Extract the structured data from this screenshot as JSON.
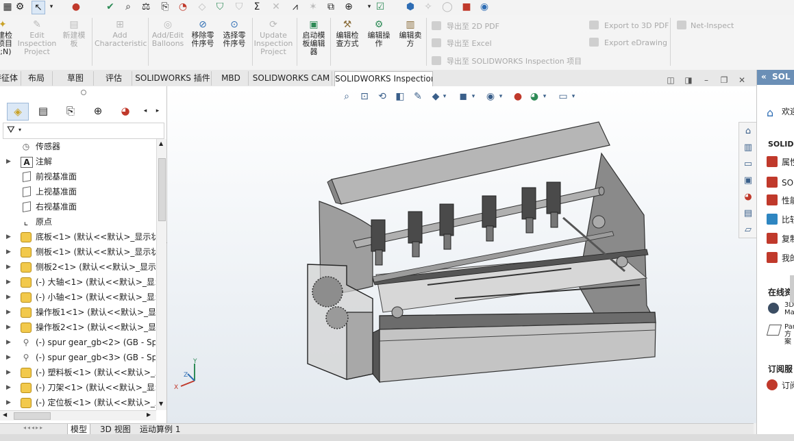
{
  "command_manager": {
    "inspection_project_label": "建检\n项目\n(;N)",
    "edit_inspection_project": "Edit\nInspection\nProject",
    "new_template": "新建模\n板",
    "add_characteristic": "Add\nCharacteristic",
    "add_edit_balloons": "Add/Edit\nBalloons",
    "remove_part_number": "移除零\n件序号",
    "select_part_number": "选择零\n件序号",
    "update_inspection_project": "Update\nInspection\nProject",
    "launch_template_editor": "启动模\n板编辑\n器",
    "edit_inspection_method": "编辑检\n查方式",
    "edit_operation": "编辑操\n作",
    "edit_vendor": "编辑卖\n方",
    "export_2d_pdf": "导出至 2D PDF",
    "export_excel": "导出至 Excel",
    "export_solidworks_inspection": "导出至 SOLIDWORKS Inspection 项目",
    "export_3d_pdf": "Export to 3D PDF",
    "export_edrawing": "Export eDrawing",
    "net_inspect": "Net-Inspect"
  },
  "ribbon_tabs": [
    {
      "label": "特征体"
    },
    {
      "label": "布局"
    },
    {
      "label": "草图"
    },
    {
      "label": "评估"
    },
    {
      "label": "SOLIDWORKS 插件"
    },
    {
      "label": "MBD"
    },
    {
      "label": "SOLIDWORKS CAM"
    },
    {
      "label": "SOLIDWORKS Inspection"
    }
  ],
  "active_ribbon_tab": "SOLIDWORKS Inspection",
  "feature_tree": {
    "items": [
      {
        "label": "传感器",
        "icon": "sensor-icon"
      },
      {
        "label": "注解",
        "icon": "annotation-icon"
      },
      {
        "label": "前视基准面",
        "icon": "plane-icon"
      },
      {
        "label": "上视基准面",
        "icon": "plane-icon"
      },
      {
        "label": "右视基准面",
        "icon": "plane-icon"
      },
      {
        "label": "原点",
        "icon": "origin-icon"
      },
      {
        "label": "底板<1> (默认<<默认>_显示状",
        "icon": "part-icon"
      },
      {
        "label": "侧板<1> (默认<<默认>_显示状",
        "icon": "part-icon"
      },
      {
        "label": "侧板2<1> (默认<<默认>_显示状",
        "icon": "part-icon"
      },
      {
        "label": "(-) 大轴<1> (默认<<默认>_显示",
        "icon": "part-icon"
      },
      {
        "label": "(-) 小轴<1> (默认<<默认>_显示",
        "icon": "part-icon"
      },
      {
        "label": "操作板1<1> (默认<<默认>_显示",
        "icon": "part-icon"
      },
      {
        "label": "操作板2<1> (默认<<默认>_显示",
        "icon": "part-icon"
      },
      {
        "label": "(-) spur gear_gb<2> (GB - Sp",
        "icon": "bolt-icon"
      },
      {
        "label": "(-) spur gear_gb<3> (GB - Sp",
        "icon": "bolt-icon"
      },
      {
        "label": "(-) 塑料板<1> (默认<<默认>_显",
        "icon": "part-icon"
      },
      {
        "label": "(-) 刀架<1> (默认<<默认>_显示",
        "icon": "part-icon"
      },
      {
        "label": "(-) 定位板<1> (默认<<默认>_显",
        "icon": "part-icon"
      }
    ]
  },
  "bottom_tabs": [
    {
      "label": "模型"
    },
    {
      "label": "3D 视图"
    },
    {
      "label": "运动算例 1"
    }
  ],
  "task_pane": {
    "title": "SOL",
    "welcome": "欢迎",
    "section_solidworks": "SOLIDW",
    "items": [
      {
        "label": "属性",
        "color": "#c0392b"
      },
      {
        "label": "SO",
        "color": "#c0392b"
      },
      {
        "label": "性能",
        "color": "#c0392b"
      },
      {
        "label": "比较",
        "color": "#2e86c1"
      },
      {
        "label": "复制",
        "color": "#c0392b"
      },
      {
        "label": "我的",
        "color": "#c0392b"
      }
    ],
    "section_online": "在线资",
    "online_items": [
      {
        "label": "3D\nMa"
      },
      {
        "label": "Par\n方案"
      }
    ],
    "section_subscription": "订阅服",
    "subscription_item": "订阅"
  },
  "triad": {
    "x": "X",
    "y": "Y",
    "z": "Z"
  },
  "colors": {
    "accent": "#2e6db4",
    "active_tab_bg": "#ffffff",
    "part_icon": "#f2c94c",
    "model_metal": "#9a9a9a"
  }
}
